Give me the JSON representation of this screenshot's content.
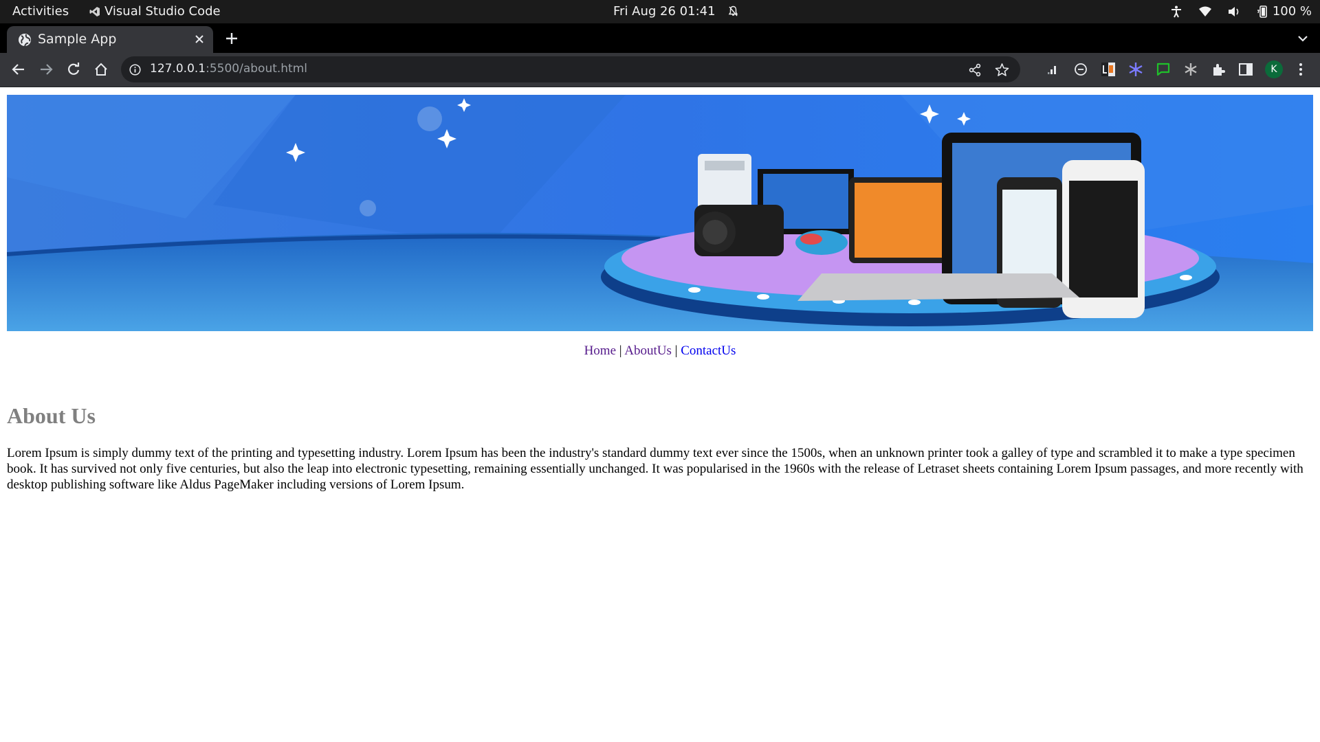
{
  "system_bar": {
    "activities": "Activities",
    "app_name": "Visual Studio Code",
    "clock": "Fri Aug 26  01:41",
    "battery": "100 %"
  },
  "browser": {
    "tab_title": "Sample App",
    "url_host": "127.0.0.1",
    "url_path": ":5500/about.html",
    "profile_initial": "K",
    "icons": [
      "back-icon",
      "forward-icon",
      "reload-icon",
      "home-icon",
      "info-icon",
      "share-icon",
      "star-icon",
      "extensions-icon",
      "menu-icon"
    ]
  },
  "page": {
    "nav": {
      "home": "Home",
      "about": "AboutUs",
      "contact": "ContactUs",
      "separator": "|"
    },
    "heading": "About Us",
    "paragraph": "Lorem Ipsum is simply dummy text of the printing and typesetting industry. Lorem Ipsum has been the industry's standard dummy text ever since the 1500s, when an unknown printer took a galley of type and scrambled it to make a type specimen book. It has survived not only five centuries, but also the leap into electronic typesetting, remaining essentially unchanged. It was popularised in the 1960s with the release of Letraset sheets containing Lorem Ipsum passages, and more recently with desktop publishing software like Aldus PageMaker including versions of Lorem Ipsum."
  },
  "colors": {
    "link_visited": "#551a8b",
    "link_unvisited": "#0000ee",
    "heading": "#808080",
    "banner_blue": "#2b7ae8"
  }
}
